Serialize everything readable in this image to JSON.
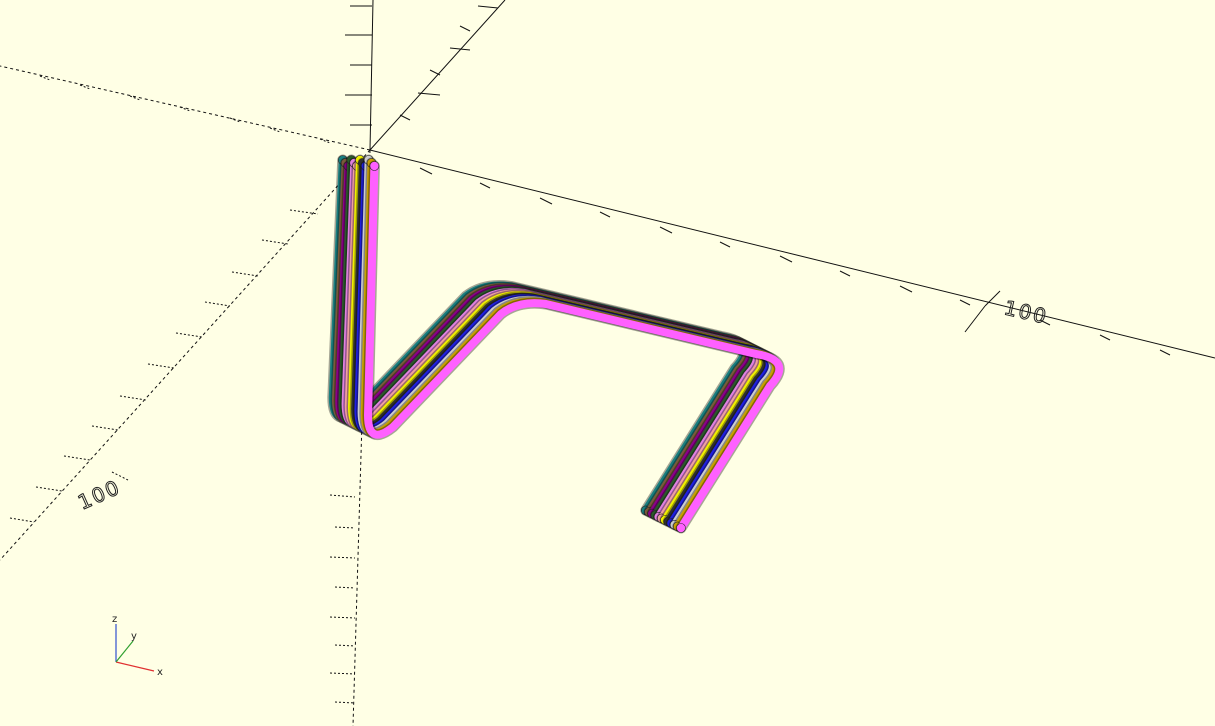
{
  "viewport": {
    "background": "#ffffe5",
    "axis_color": "#111111"
  },
  "scale_labels": {
    "x_axis": "100",
    "y_axis": "100"
  },
  "gizmo": {
    "x": "x",
    "y": "y",
    "z": "z",
    "x_color": "#e03030",
    "y_color": "#30a030",
    "z_color": "#3050d0"
  },
  "cable_bundle": {
    "wire_colors": [
      "#1a7f7f",
      "#7a5a3a",
      "#8a008a",
      "#2a5a2a",
      "#e080e0",
      "#f0a0a0",
      "#f0f000",
      "#303030",
      "#2020e0",
      "#cccccc",
      "#c8a000",
      "#ff60ff"
    ]
  }
}
